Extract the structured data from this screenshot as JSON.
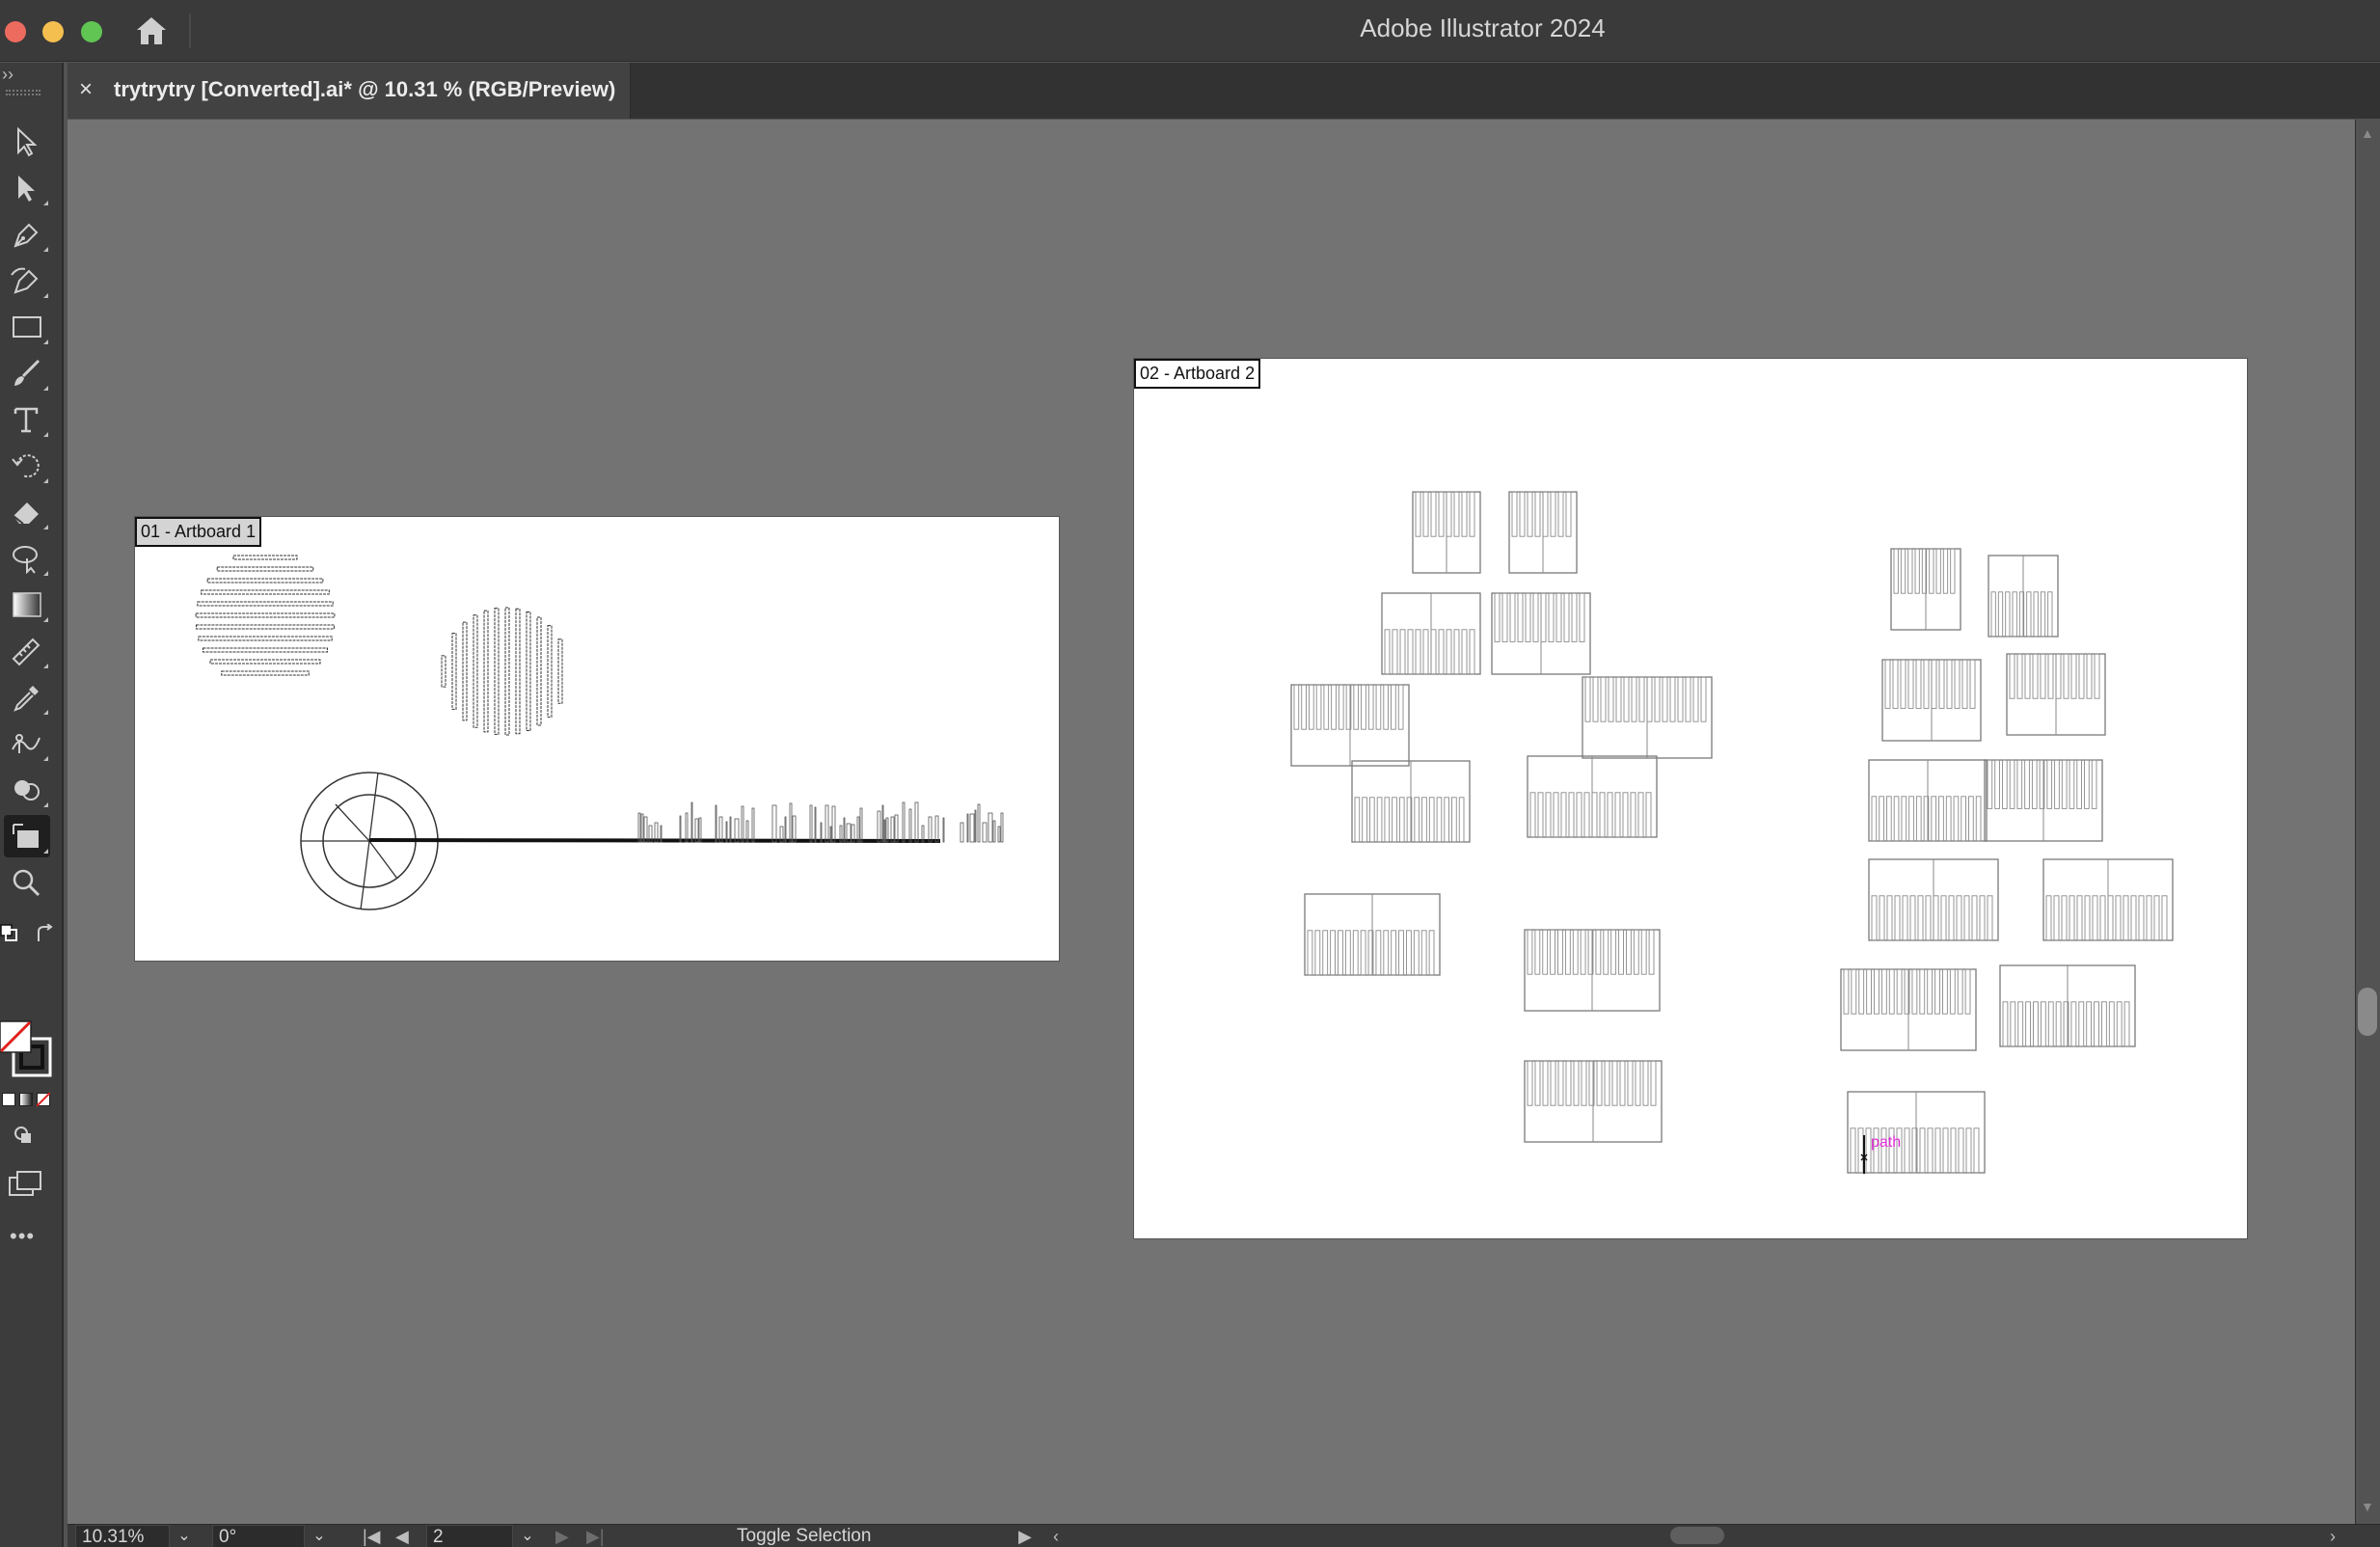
{
  "window": {
    "app_title": "Adobe Illustrator 2024"
  },
  "tab": {
    "close_glyph": "×",
    "title": "trytrytry [Converted].ai* @ 10.31 % (RGB/Preview)"
  },
  "toolbar": {
    "collapse_glyph": "››",
    "tools": [
      {
        "name": "selection-tool",
        "icon": "arrow-icon"
      },
      {
        "name": "direct-selection-tool",
        "icon": "direct-arrow-icon"
      },
      {
        "name": "pen-tool",
        "icon": "pen-icon"
      },
      {
        "name": "curvature-tool",
        "icon": "curvature-pen-icon"
      },
      {
        "name": "rectangle-tool",
        "icon": "rectangle-icon"
      },
      {
        "name": "paintbrush-tool",
        "icon": "brush-icon"
      },
      {
        "name": "type-tool",
        "icon": "type-icon"
      },
      {
        "name": "rotate-tool",
        "icon": "rotate-icon"
      },
      {
        "name": "eraser-tool",
        "icon": "eraser-icon"
      },
      {
        "name": "lasso-tool",
        "icon": "lasso-icon"
      },
      {
        "name": "gradient-tool",
        "icon": "gradient-icon"
      },
      {
        "name": "measure-tool",
        "icon": "ruler-icon"
      },
      {
        "name": "eyedropper-tool",
        "icon": "eyedropper-icon"
      },
      {
        "name": "puppet-warp-tool",
        "icon": "puppet-warp-icon"
      },
      {
        "name": "shape-builder-tool",
        "icon": "shape-builder-icon"
      },
      {
        "name": "artboard-tool",
        "icon": "artboard-icon",
        "active": true
      },
      {
        "name": "zoom-tool",
        "icon": "magnifier-icon"
      }
    ],
    "more_glyph": "•••"
  },
  "artboards": [
    {
      "label": "01 - Artboard 1",
      "selected": true
    },
    {
      "label": "02 - Artboard 2",
      "selected": false
    }
  ],
  "hover_hint": "path",
  "status": {
    "zoom": "10.31%",
    "rotation": "0°",
    "artboard_number": "2",
    "tool_hint": "Toggle Selection",
    "chevron": "⌄",
    "first_glyph": "|◀",
    "prev_glyph": "◀",
    "next_glyph": "▶",
    "last_glyph": "▶|",
    "play_glyph": "▶",
    "left_glyph": "‹",
    "right_glyph": "›"
  },
  "colors": {
    "accent_path_hint": "#e02bd6",
    "canvas": "#737373",
    "chrome": "#3c3c3c"
  }
}
